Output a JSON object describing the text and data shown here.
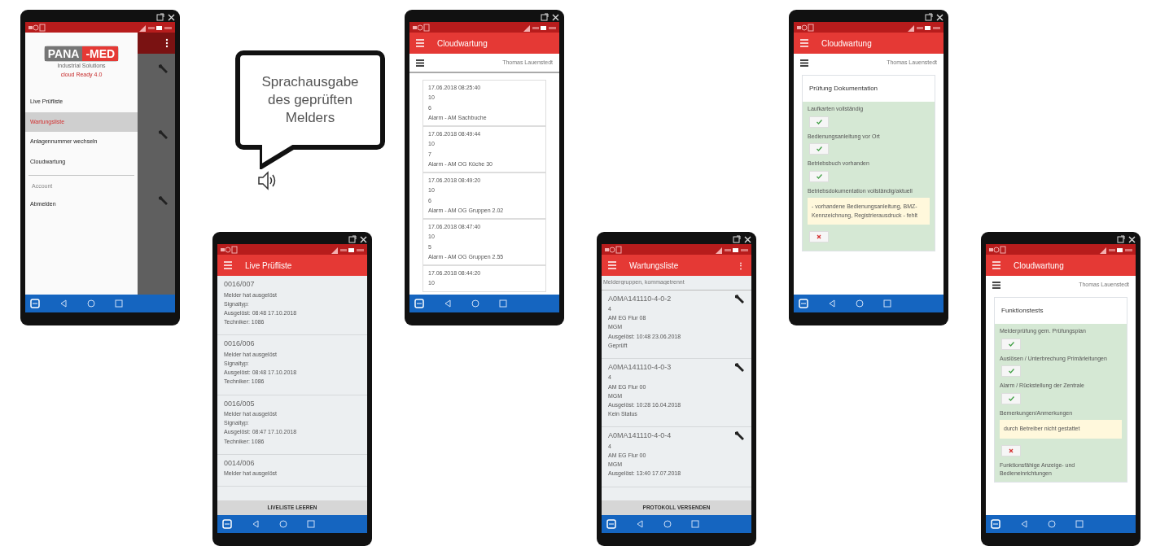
{
  "phones": [
    {
      "kind": "drawer",
      "logo": {
        "left": "PANA",
        "right": "-MED",
        "tagline": "Industrial Solutions",
        "edition": "cloud Ready 4.0"
      },
      "menu": [
        {
          "label": "Live Prüfliste",
          "selected": false
        },
        {
          "label": "Wartungsliste",
          "selected": true
        },
        {
          "label": "Anlagennummer wechseln",
          "selected": false
        },
        {
          "label": "Cloudwartung",
          "selected": false
        }
      ],
      "section": "Account",
      "account_menu": [
        {
          "label": "Abmelden",
          "selected": false
        }
      ]
    },
    {
      "kind": "list",
      "callout": "Sprachausgabe des geprüften Melders",
      "title": "Live Prüfliste",
      "entries": [
        {
          "id": "0016/007",
          "lines": [
            "Melder hat ausgelöst",
            "Signaltyp:",
            "Ausgelöst: 08:48 17.10.2018",
            "Techniker: 1086"
          ]
        },
        {
          "id": "0016/006",
          "lines": [
            "Melder hat ausgelöst",
            "Signaltyp:",
            "Ausgelöst: 08:48 17.10.2018",
            "Techniker: 1086"
          ]
        },
        {
          "id": "0016/005",
          "lines": [
            "Melder hat ausgelöst",
            "Signaltyp:",
            "Ausgelöst: 08:47 17.10.2018",
            "Techniker: 1086"
          ]
        },
        {
          "id": "0014/006",
          "lines": [
            "Melder hat ausgelöst"
          ]
        }
      ],
      "button": "LIVELISTE LEEREN"
    },
    {
      "kind": "records",
      "title": "Cloudwartung",
      "user": "Thomas Lauenstedt",
      "records": [
        {
          "lines": [
            "17.06.2018 08:25:40",
            "10",
            "6",
            "Alarm - AM Sachbuche"
          ]
        },
        {
          "lines": [
            "17.06.2018 08:49:44",
            "10",
            "7",
            "Alarm - AM OG Küche 30"
          ]
        },
        {
          "lines": [
            "17.06.2018 08:49:20",
            "10",
            "6",
            "Alarm - AM OG Gruppen 2.02"
          ]
        },
        {
          "lines": [
            "17.06.2018 08:47:40",
            "10",
            "5",
            "Alarm - AM OG Gruppen 2.55"
          ]
        },
        {
          "lines": [
            "17.06.2018 08:44:20",
            "10"
          ]
        }
      ]
    },
    {
      "kind": "list",
      "title": "Wartungsliste",
      "menu_button": "⋮",
      "filter_placeholder": "Meldergruppen, kommagetrennt",
      "entries": [
        {
          "id": "A0MA141110-4-0-2",
          "wrench": true,
          "lines": [
            "4",
            "AM EG Flur 08",
            "MGM",
            "Ausgelöst: 10:48 23.06.2018",
            "Geprüft"
          ]
        },
        {
          "id": "A0MA141110-4-0-3",
          "wrench": true,
          "lines": [
            "4",
            "AM EG Flur 00",
            "MGM",
            "Ausgelöst: 10:28 16.04.2018",
            "Kein Status"
          ]
        },
        {
          "id": "A0MA141110-4-0-4",
          "wrench": true,
          "lines": [
            "4",
            "AM EG Flur 00",
            "MGM",
            "Ausgelöst: 13:40 17.07.2018"
          ]
        }
      ],
      "button": "PROTOKOLL VERSENDEN"
    },
    {
      "kind": "form",
      "title": "Cloudwartung",
      "user": "Thomas Lauenstedt",
      "heading": "Prüfung Dokumentation",
      "items": [
        {
          "kind": "check",
          "label": "Laufkarten vollständig",
          "checked": true
        },
        {
          "kind": "check",
          "label": "Bedienungsanleitung vor Ort",
          "checked": true
        },
        {
          "kind": "check",
          "label": "Betriebsbuch vorhanden",
          "checked": true
        },
        {
          "kind": "note",
          "label": "Betriebsdokumentation vollständig/aktuell",
          "text": "- vorhandene Bedienungsanleitung, BMZ-Kennzeichnung, Registrierausdruck - fehlt"
        },
        {
          "kind": "check",
          "checked": false
        }
      ]
    },
    {
      "kind": "form",
      "title": "Cloudwartung",
      "user": "Thomas Lauenstedt",
      "heading": "Funktionstests",
      "items": [
        {
          "kind": "check",
          "label": "Melderprüfung gem. Prüfungsplan",
          "checked": true
        },
        {
          "kind": "check",
          "label": "Auslösen / Unterbrechung Primärleitungen",
          "checked": true
        },
        {
          "kind": "check",
          "label": "Alarm / Rückstellung der Zentrale",
          "checked": true
        },
        {
          "kind": "note",
          "label": "Bemerkungen/Anmerkungen",
          "text": "durch Betreiber nicht gestattet"
        },
        {
          "kind": "check",
          "checked": false
        },
        {
          "kind": "label",
          "label": "Funktionsfähige Anzeige- und Bedieneinrichtungen"
        }
      ]
    }
  ]
}
